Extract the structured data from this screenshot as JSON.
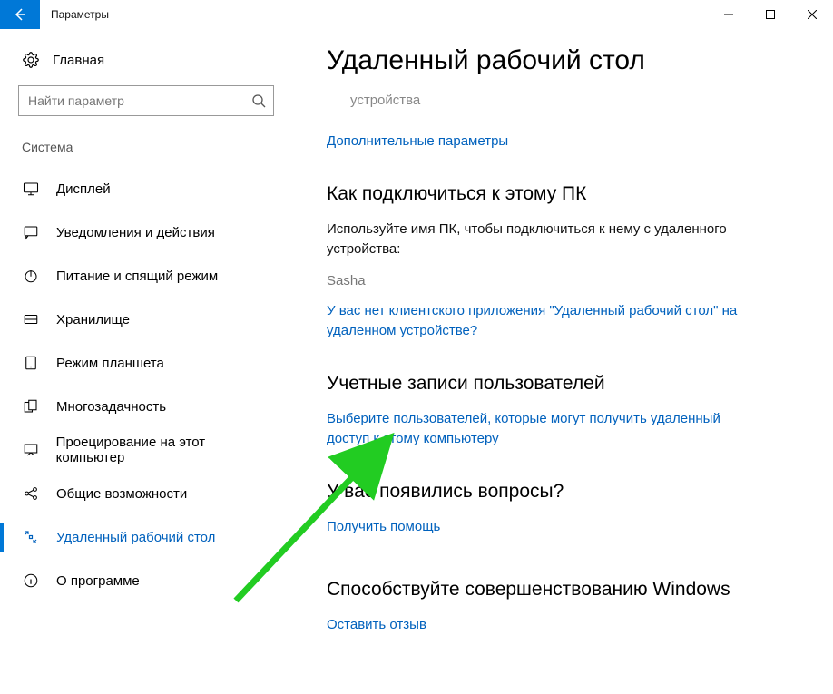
{
  "window": {
    "title": "Параметры"
  },
  "sidebar": {
    "home": "Главная",
    "search_placeholder": "Найти параметр",
    "group": "Система",
    "items": [
      {
        "label": "Дисплей"
      },
      {
        "label": "Уведомления и действия"
      },
      {
        "label": "Питание и спящий режим"
      },
      {
        "label": "Хранилище"
      },
      {
        "label": "Режим планшета"
      },
      {
        "label": "Многозадачность"
      },
      {
        "label": "Проецирование на этот компьютер"
      },
      {
        "label": "Общие возможности"
      },
      {
        "label": "Удаленный рабочий стол"
      },
      {
        "label": "О программе"
      }
    ]
  },
  "content": {
    "title": "Удаленный рабочий стол",
    "device_muted": "устройства",
    "advanced_link": "Дополнительные параметры",
    "connect": {
      "heading": "Как подключиться к этому ПК",
      "instruction": "Используйте имя ПК, чтобы подключиться к нему с удаленного устройства:",
      "pc_name": "Sasha",
      "no_client_link": "У вас нет клиентского приложения \"Удаленный рабочий стол\" на удаленном устройстве?"
    },
    "accounts": {
      "heading": "Учетные записи пользователей",
      "select_users_link": "Выберите пользователей, которые могут получить удаленный доступ к этому компьютеру"
    },
    "questions": {
      "heading": "У вас появились вопросы?",
      "help_link": "Получить помощь"
    },
    "feedback": {
      "heading": "Способствуйте совершенствованию Windows",
      "feedback_link": "Оставить отзыв"
    }
  }
}
